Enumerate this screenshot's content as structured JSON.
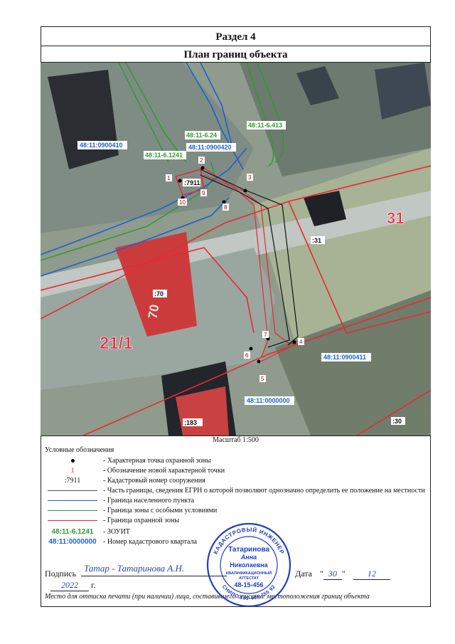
{
  "header": {
    "section": "Раздел 4",
    "plan_title": "План границ объекта"
  },
  "map": {
    "quarter_labels": [
      "48:11:0900410",
      "48:11:0900420",
      "48:11:0900411",
      "48:11:0000000"
    ],
    "zone_labels": [
      "48:11-6.24",
      "48:11-6.413",
      "48:11-6.1241"
    ],
    "parcel_labels": [
      ":7911",
      ":31",
      ":70",
      ":183",
      ":30"
    ],
    "ground_marks": [
      "31",
      "21/1",
      "70"
    ],
    "points": [
      "1",
      "2",
      "3",
      "4",
      "5",
      "6",
      "7",
      "8",
      "9",
      "10"
    ]
  },
  "scale": "Масштаб 1:500",
  "legend": {
    "title": "Условные обозначения",
    "items": [
      "- Характерная точка охранной зоны",
      "- Обозначение новой характерной точки",
      "- Кадастровый номер сооружения",
      "- Часть границы, сведения ЕГРН о которой позволяют однозначно определить ее положение на местности",
      "- Граница населенного пункта",
      "- Граница зоны с особыми условиями",
      "- Граница охранной зоны",
      "- ЗОУИТ",
      "- Номер кадастрового квартала"
    ],
    "sample_point": "1",
    "sample_parcel": ":7911",
    "sample_zone": "48:11-6.1241",
    "sample_quarter": "48:11:0000000"
  },
  "signature": {
    "label": "Подпись",
    "scribble": "Татар - Татаринова А.Н.",
    "date_label": "Дата",
    "day": "30",
    "month": "12",
    "year": "2022",
    "year_suffix": "г."
  },
  "note": "Место для оттиска печати (при наличии) лица, составившего описание местоположения границ объекта",
  "stamp": {
    "top_text": "КАДАСТРОВЫЙ ИНЖЕНЕР",
    "name1": "Татаринова",
    "name2": "Анна",
    "name3": "Николаевна",
    "cert1": "КВАЛИФИКАЦИОННЫЙ",
    "cert2": "АТТЕСТАТ",
    "cert_no": "48-15-456",
    "bottom_text": "СНИЛС 135-445-755 92"
  },
  "colors": {
    "red": "#e8283a",
    "blue": "#1e5fd0",
    "green": "#2f9a2f",
    "stamp": "#1f3fbf"
  }
}
